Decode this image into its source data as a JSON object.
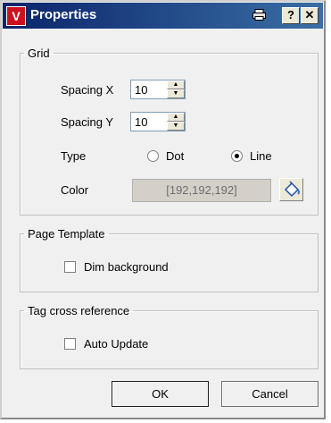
{
  "window": {
    "title": "Properties",
    "app_icon": "app-logo-icon",
    "buttons": {
      "help": "?",
      "close": "✕",
      "print_icon": "printer-icon"
    }
  },
  "grid": {
    "legend": "Grid",
    "spacing_x_label": "Spacing X",
    "spacing_x_value": "10",
    "spacing_y_label": "Spacing Y",
    "spacing_y_value": "10",
    "type_label": "Type",
    "type_options": [
      "Dot",
      "Line"
    ],
    "type_selected": "Line",
    "color_label": "Color",
    "color_value": "[192,192,192]",
    "color_hex": "#c0c0c0"
  },
  "page_template": {
    "legend": "Page Template",
    "dim_background_label": "Dim background",
    "dim_background_checked": false
  },
  "tag_cross_reference": {
    "legend": "Tag cross reference",
    "auto_update_label": "Auto Update",
    "auto_update_checked": false
  },
  "footer": {
    "ok_label": "OK",
    "cancel_label": "Cancel"
  }
}
